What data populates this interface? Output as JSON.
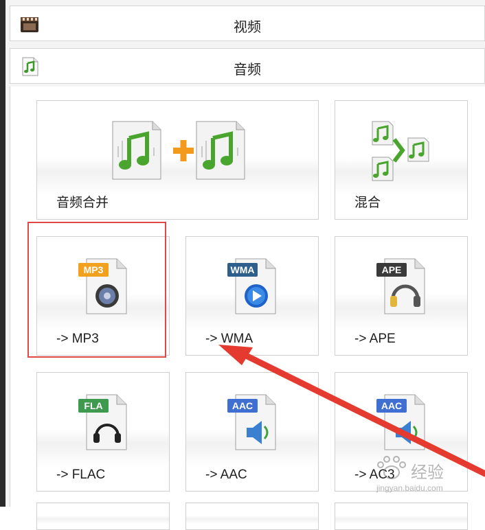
{
  "categories": [
    {
      "label": "视频",
      "icon": "film-clapper-icon"
    },
    {
      "label": "音频",
      "icon": "music-note-icon"
    }
  ],
  "tiles": [
    {
      "label": "音频合并",
      "icon": "audio-merge-icon"
    },
    {
      "label": "混合",
      "icon": "audio-mix-icon"
    },
    {
      "label": "-> MP3",
      "icon": "mp3-file-icon",
      "badge": "MP3",
      "badge_color": "#f2a11f"
    },
    {
      "label": "-> WMA",
      "icon": "wma-file-icon",
      "badge": "WMA",
      "badge_color": "#2e5f8c"
    },
    {
      "label": "-> APE",
      "icon": "ape-file-icon",
      "badge": "APE",
      "badge_color": "#3a3a3a"
    },
    {
      "label": "-> FLAC",
      "icon": "flac-file-icon",
      "badge": "FLA",
      "badge_color": "#3e9a4e"
    },
    {
      "label": "-> AAC",
      "icon": "aac-file-icon",
      "badge": "AAC",
      "badge_color": "#3f6fd1"
    },
    {
      "label": "-> AC3",
      "icon": "ac3-file-icon",
      "badge": "AAC",
      "badge_color": "#3f6fd1"
    }
  ],
  "annotation": {
    "highlight_color": "#e04848",
    "arrow_color": "#e53a2f"
  },
  "watermark": {
    "brand": "经验",
    "url": "jingyan.baidu.com"
  }
}
